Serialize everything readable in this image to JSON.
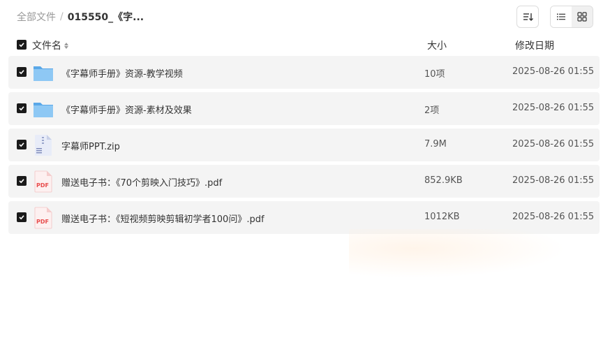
{
  "breadcrumb": {
    "root": "全部文件",
    "separator": "/",
    "current": "015550_《字..."
  },
  "toolbar": {
    "sort_icon": "sort-lines-icon",
    "list_view_icon": "list-view-icon",
    "grid_view_icon": "grid-view-icon"
  },
  "header": {
    "name": "文件名",
    "size": "大小",
    "date": "修改日期"
  },
  "files": [
    {
      "name": "《字幕师手册》资源-教学视频",
      "size": "10项",
      "date": "2025-08-26 01:55",
      "type": "folder"
    },
    {
      "name": "《字幕师手册》资源-素材及效果",
      "size": "2项",
      "date": "2025-08-26 01:55",
      "type": "folder"
    },
    {
      "name": "字幕师PPT.zip",
      "size": "7.9M",
      "date": "2025-08-26 01:55",
      "type": "zip"
    },
    {
      "name": "赠送电子书：《70个剪映入门技巧》.pdf",
      "size": "852.9KB",
      "date": "2025-08-26 01:55",
      "type": "pdf"
    },
    {
      "name": "赠送电子书：《短视频剪映剪辑初学者100问》.pdf",
      "size": "1012KB",
      "date": "2025-08-26 01:55",
      "type": "pdf"
    }
  ],
  "pdf_label": "PDF",
  "colors": {
    "folder": "#7dbcf0",
    "pdf": "#e84c4c",
    "row_bg": "#f4f4f4"
  }
}
